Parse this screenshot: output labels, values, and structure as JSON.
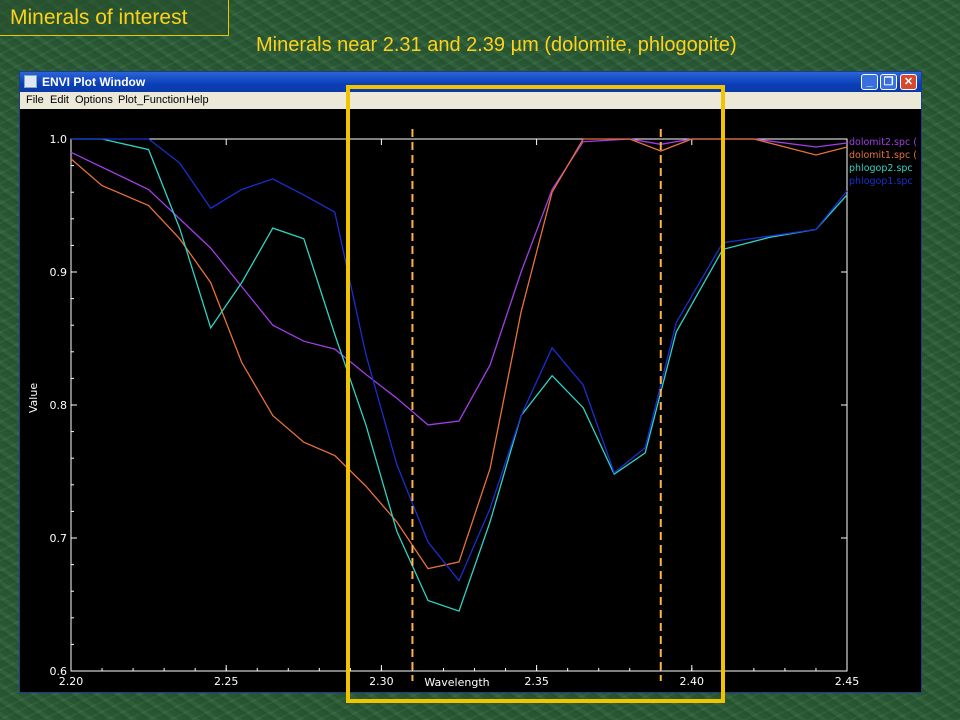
{
  "slide": {
    "title": "Minerals of interest",
    "subtitle": "Minerals near 2.31 and 2.39 µm (dolomite, phlogopite)"
  },
  "window": {
    "title": "ENVI Plot Window",
    "menu": [
      "File",
      "Edit",
      "Options",
      "Plot_Function",
      "Help"
    ],
    "icons": [
      "minimize-icon",
      "restore-icon",
      "close-icon"
    ]
  },
  "colors": {
    "highlight_box": "#f2c400",
    "marker_lines": "#ffb347"
  },
  "chart_data": {
    "type": "line",
    "xlabel": "Wavelength",
    "ylabel": "Value",
    "xlim": [
      2.2,
      2.45
    ],
    "ylim": [
      0.6,
      1.0
    ],
    "x_ticks": [
      "2.20",
      "2.25",
      "2.30",
      "2.35",
      "2.40",
      "2.45"
    ],
    "y_ticks": [
      "0.6",
      "0.7",
      "0.8",
      "0.9",
      "1.0"
    ],
    "vertical_markers": [
      2.31,
      2.39
    ],
    "highlight_range": [
      2.29,
      2.41
    ],
    "legend_position": "top-right",
    "series": [
      {
        "name": "dolomit2.spc (",
        "color": "#a23de8",
        "x": [
          2.2,
          2.225,
          2.245,
          2.265,
          2.275,
          2.285,
          2.295,
          2.305,
          2.315,
          2.325,
          2.335,
          2.345,
          2.355,
          2.365,
          2.38,
          2.39,
          2.4,
          2.42,
          2.44,
          2.45
        ],
        "y": [
          0.99,
          0.962,
          0.918,
          0.86,
          0.848,
          0.842,
          0.823,
          0.805,
          0.785,
          0.788,
          0.83,
          0.9,
          0.962,
          0.998,
          1.0,
          0.996,
          1.0,
          1.0,
          0.994,
          0.997
        ]
      },
      {
        "name": "dolomit1.spc (",
        "color": "#e8713a",
        "x": [
          2.2,
          2.21,
          2.225,
          2.235,
          2.245,
          2.255,
          2.265,
          2.275,
          2.285,
          2.295,
          2.305,
          2.315,
          2.325,
          2.335,
          2.345,
          2.355,
          2.365,
          2.38,
          2.39,
          2.4,
          2.42,
          2.44,
          2.45
        ],
        "y": [
          0.985,
          0.965,
          0.95,
          0.925,
          0.892,
          0.832,
          0.792,
          0.772,
          0.762,
          0.739,
          0.712,
          0.677,
          0.682,
          0.752,
          0.87,
          0.96,
          1.0,
          1.0,
          0.991,
          1.0,
          1.0,
          0.988,
          0.994
        ]
      },
      {
        "name": "phlogop2.spc",
        "color": "#2fd3c4",
        "x": [
          2.2,
          2.21,
          2.225,
          2.235,
          2.245,
          2.255,
          2.265,
          2.275,
          2.285,
          2.295,
          2.305,
          2.315,
          2.325,
          2.335,
          2.345,
          2.355,
          2.365,
          2.375,
          2.385,
          2.395,
          2.41,
          2.425,
          2.44,
          2.45
        ],
        "y": [
          1.0,
          1.0,
          0.992,
          0.933,
          0.858,
          0.892,
          0.933,
          0.925,
          0.853,
          0.785,
          0.705,
          0.653,
          0.645,
          0.712,
          0.792,
          0.822,
          0.798,
          0.748,
          0.764,
          0.855,
          0.917,
          0.926,
          0.932,
          0.958
        ]
      },
      {
        "name": "phlogop1.spc",
        "color": "#1a2fd0",
        "x": [
          2.2,
          2.21,
          2.225,
          2.235,
          2.245,
          2.255,
          2.265,
          2.275,
          2.285,
          2.295,
          2.305,
          2.315,
          2.325,
          2.335,
          2.345,
          2.355,
          2.365,
          2.375,
          2.385,
          2.395,
          2.41,
          2.425,
          2.44,
          2.45
        ],
        "y": [
          1.0,
          1.0,
          1.0,
          0.982,
          0.948,
          0.962,
          0.97,
          0.958,
          0.945,
          0.838,
          0.755,
          0.697,
          0.668,
          0.722,
          0.792,
          0.843,
          0.815,
          0.749,
          0.768,
          0.862,
          0.922,
          0.927,
          0.932,
          0.961
        ]
      }
    ]
  }
}
